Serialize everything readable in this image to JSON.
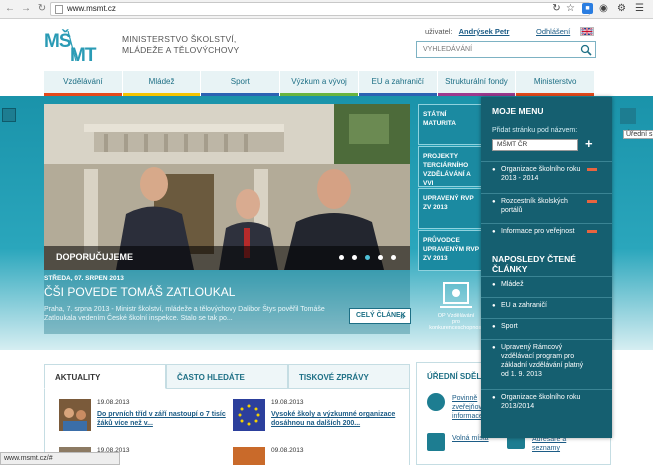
{
  "browser": {
    "url": "www.msmt.cz",
    "status_text": "www.msmt.cz/#"
  },
  "header": {
    "ministry_line1": "MINISTERSTVO ŠKOLSTVÍ,",
    "ministry_line2": "MLÁDEŽE A TĚLOVÝCHOVY",
    "user_label": "uživatel:",
    "user_name": "Andrýsek Petr",
    "logout": "Odhlášení",
    "search_placeholder": "VYHLEDÁVÁNÍ"
  },
  "nav": {
    "items": [
      {
        "label": "Vzdělávání",
        "color": "#e4491b"
      },
      {
        "label": "Mládež",
        "color": "#f5c400"
      },
      {
        "label": "Sport",
        "color": "#2b62b3"
      },
      {
        "label": "Výzkum a vývoj",
        "color": "#6ab43e"
      },
      {
        "label": "EU a zahraničí",
        "color": "#2b62b3"
      },
      {
        "label": "Strukturální fondy",
        "color": "#9c3a8e"
      },
      {
        "label": "Ministerstvo",
        "color": "#e4491b"
      }
    ]
  },
  "hero": {
    "tag": "DOPORUČUJEME",
    "slides": 5,
    "active_slide": 3
  },
  "article": {
    "date": "STŘEDA, 07. SRPEN 2013",
    "title": "ČŠI POVEDE TOMÁŠ ZATLOUKAL",
    "text": "Praha, 7. srpna 2013 - Ministr školství, mládeže a tělovýchovy Dalibor Štys pověřil Tomáše Zatloukala vedením České školní inspekce. Stalo se tak po...",
    "more": "CELÝ ČLÁNEK"
  },
  "tiles": [
    {
      "label": "STÁTNÍ MATURITA"
    },
    {
      "label": "PROJEKTY TERCIÁRNÍHO VZDĚLÁVÁNÍ A VVI"
    },
    {
      "label": "UPRAVENÝ RVP ZV 2013"
    },
    {
      "label": "PRŮVODCE UPRAVENÝM RVP ZV 2013"
    }
  ],
  "op_logo": {
    "line1": "OP Vzdělávání",
    "line2": "pro konkurenceschopnost"
  },
  "tabs": [
    {
      "label": "AKTUALITY",
      "active": true
    },
    {
      "label": "ČASTO HLEDÁTE",
      "active": false
    },
    {
      "label": "TISKOVÉ ZPRÁVY",
      "active": false
    }
  ],
  "news": [
    {
      "date": "19.08.2013",
      "title": "Do prvních tříd v září nastoupí o 7 tisíc žáků více než v..."
    },
    {
      "date": "19.08.2013",
      "title": "Vysoké školy a výzkumné organizace dosáhnou na dalších 200..."
    },
    {
      "date": "19.08.2013",
      "title": ""
    },
    {
      "date": "09.08.2013",
      "title": ""
    }
  ],
  "board": {
    "heading": "ÚŘEDNÍ SDĚLENÍ",
    "links": [
      "Povinně zveřejňované informace",
      "Volná místa",
      "Adresáře a seznamy"
    ]
  },
  "my_menu": {
    "heading": "MOJE MENU",
    "add_label": "Přidat stránku pod názvem:",
    "field_value": "MŠMT ČR",
    "saved": [
      "Organizace školního roku 2013 - 2014",
      "Rozcestník školských portálů",
      "Informace pro veřejnost"
    ],
    "recent_heading": "NAPOSLEDY ČTENÉ ČLÁNKY",
    "recent": [
      "Mládež",
      "EU a zahraničí",
      "Sport",
      "Upravený Rámcový vzdělávací program pro základní vzdělávání platný od 1. 9. 2013",
      "Organizace školního roku 2013/2014"
    ]
  },
  "tooltip": "Úřední s"
}
